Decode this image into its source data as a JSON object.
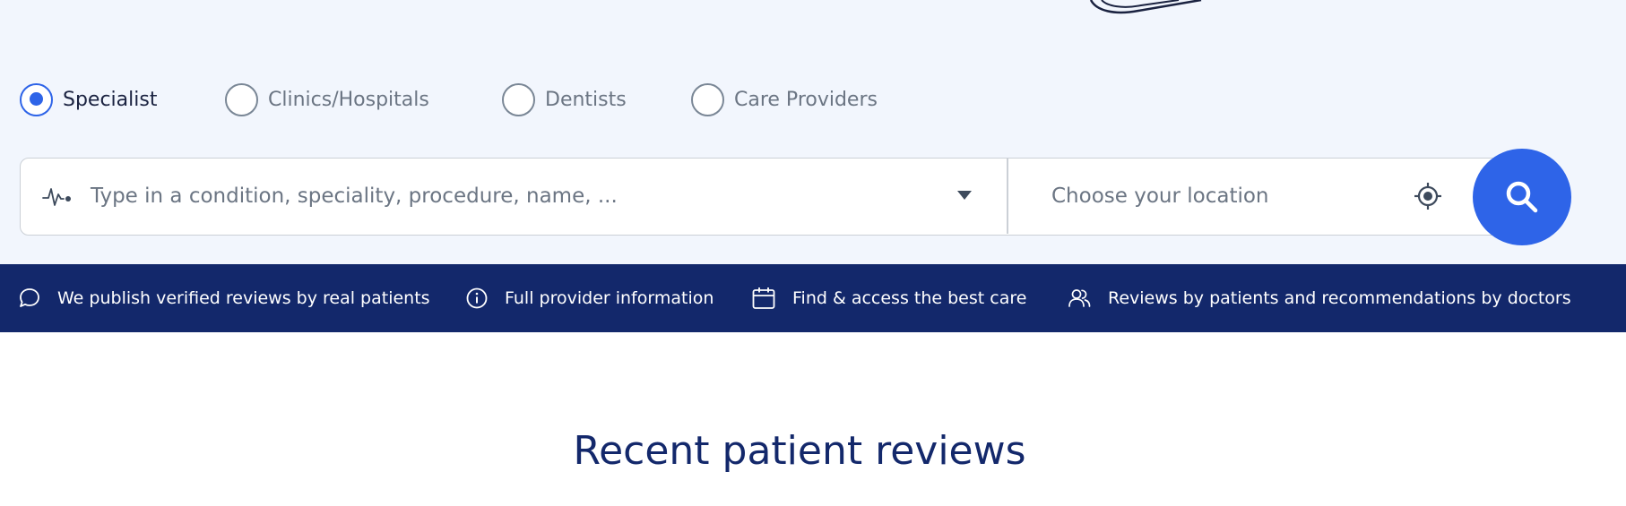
{
  "provider_types": [
    {
      "label": "Specialist",
      "checked": true
    },
    {
      "label": "Clinics/Hospitals",
      "checked": false
    },
    {
      "label": "Dentists",
      "checked": false
    },
    {
      "label": "Care Providers",
      "checked": false
    }
  ],
  "search": {
    "condition_placeholder": "Type in a condition, speciality, procedure, name, ...",
    "condition_value": "",
    "location_placeholder": "Choose your location",
    "location_value": ""
  },
  "trust_bar": {
    "items": [
      {
        "icon": "chat-bubble-icon",
        "label": "We publish verified reviews by real patients"
      },
      {
        "icon": "info-icon",
        "label": "Full provider information"
      },
      {
        "icon": "calendar-icon",
        "label": "Find & access the best care"
      },
      {
        "icon": "users-icon",
        "label": "Reviews by patients and recommendations by doctors"
      }
    ]
  },
  "section": {
    "title": "Recent patient reviews"
  },
  "colors": {
    "hero_background": "#f2f6fd",
    "accent": "#2e64e8",
    "navy": "#13286b",
    "muted_text": "#6b7583"
  }
}
